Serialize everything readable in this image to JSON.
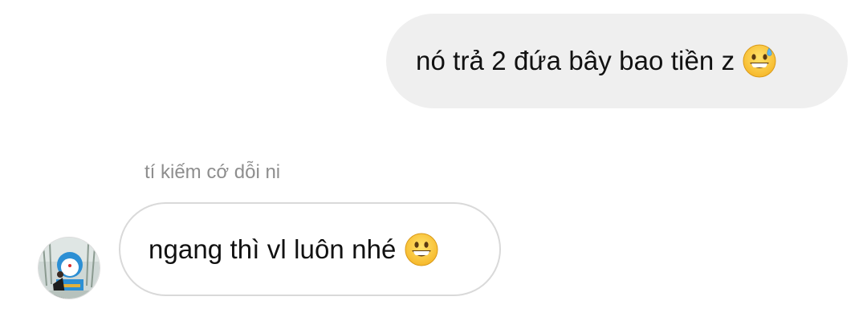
{
  "messages": [
    {
      "direction": "outgoing",
      "text": "nó trả 2 đứa bây bao tiền z",
      "emoji": "grinning-face-with-sweat"
    },
    {
      "direction": "incoming",
      "sender": "tí kiếm cớ dỗi ni",
      "text": "ngang thì vl luôn nhé",
      "emoji": "grinning-face"
    }
  ],
  "colors": {
    "outgoing_bubble": "#efefef",
    "incoming_border": "#d9d9d9",
    "sender_name": "#8e8e8e",
    "message_text": "#111111"
  },
  "icons": {
    "avatar": "avatar-image",
    "emoji_1": "grinning-face-with-sweat-icon",
    "emoji_2": "grinning-face-icon"
  }
}
